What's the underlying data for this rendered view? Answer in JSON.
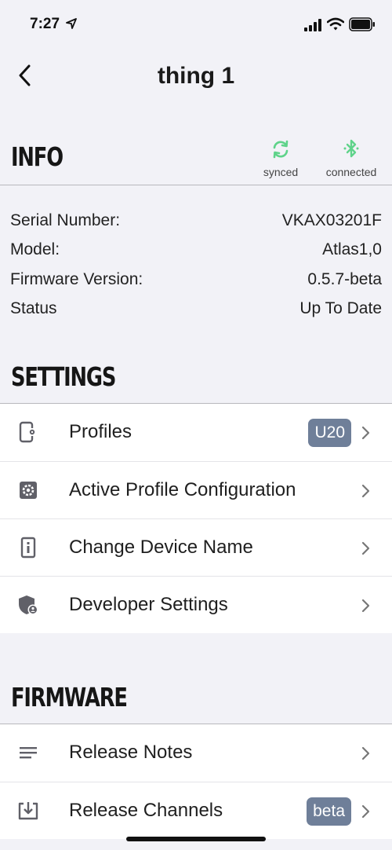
{
  "status_bar": {
    "time": "7:27"
  },
  "nav": {
    "title": "thing 1"
  },
  "info": {
    "heading": "INFO",
    "sync_label": "synced",
    "connection_label": "connected",
    "rows": [
      {
        "label": "Serial Number:",
        "value": "VKAX03201F"
      },
      {
        "label": "Model:",
        "value": "Atlas1,0"
      },
      {
        "label": "Firmware Version:",
        "value": "0.5.7-beta"
      },
      {
        "label": "Status",
        "value": "Up To Date"
      }
    ]
  },
  "settings": {
    "heading": "SETTINGS",
    "items": [
      {
        "label": "Profiles",
        "badge": "U20",
        "icon": "device-settings-icon"
      },
      {
        "label": "Active Profile Configuration",
        "icon": "gear-icon"
      },
      {
        "label": "Change Device Name",
        "icon": "device-info-icon"
      },
      {
        "label": "Developer Settings",
        "icon": "shield-user-icon"
      }
    ]
  },
  "firmware": {
    "heading": "FIRMWARE",
    "items": [
      {
        "label": "Release Notes",
        "icon": "notes-icon"
      },
      {
        "label": "Release Channels",
        "badge": "beta",
        "icon": "download-box-icon"
      }
    ]
  },
  "colors": {
    "accent_green": "#5fd38a",
    "badge_bg": "#6f7f99",
    "background": "#f2f2f7"
  }
}
